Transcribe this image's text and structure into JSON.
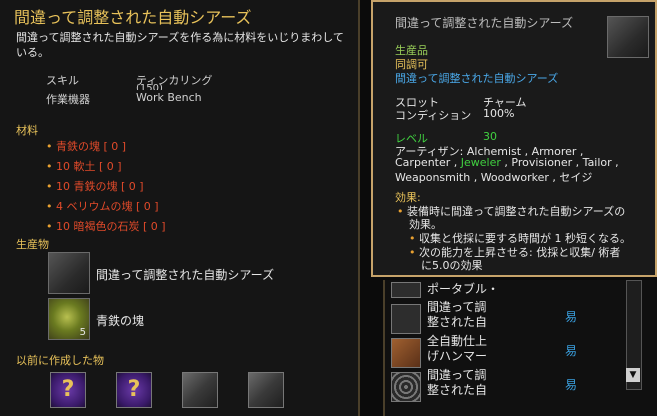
{
  "recipe": {
    "title": "間違って調整された自動シアーズ",
    "description": "間違って調整された自動シアーズを作る為に材料をいじりまわしている。",
    "skill_label": "スキル",
    "skill_value": "ティンカリング",
    "skill_sub": "(150)",
    "tool_label": "作業機器",
    "tool_value": "Work Bench",
    "materials_heading": "材料",
    "materials": [
      "青鉄の塊 [ 0 ]",
      "10 軟土 [ 0 ]",
      "10 青鉄の塊 [ 0 ]",
      "4 ベリウムの塊 [ 0 ]",
      "10 暗褐色の石炭 [ 0 ]"
    ],
    "products_heading": "生産物",
    "products": [
      {
        "name": "間違って調整された自動シアーズ",
        "icon": "scythe-icon",
        "count": ""
      },
      {
        "name": "青鉄の塊",
        "icon": "ore-icon",
        "count": "5"
      }
    ],
    "previous_heading": "以前に作成した物",
    "previous_items": [
      "question-icon",
      "question-icon",
      "scythe-icon",
      "scythe-icon"
    ]
  },
  "tooltip": {
    "title": "間違って調整された自動シアーズ",
    "line1": "生産品",
    "line2": "同調可",
    "line3": "間違って調整された自動シアーズ",
    "slot_label": "スロット",
    "slot_value": "チャーム",
    "condition_label": "コンディション",
    "condition_value": "100%",
    "level_label": "レベル",
    "level_value": "30",
    "artisans_label": "アーティザン:",
    "artisans_line1": "Alchemist , Armorer ,",
    "artisans_line2_a": "Carpenter ,",
    "artisans_line2_b": "Jeweler",
    "artisans_line2_c": ", Provisioner , Tailor ,",
    "artisans_line3": "Weaponsmith , Woodworker , セイジ",
    "effects_heading": "効果:",
    "effect1_a": "装備時に間違って調整された自動シアーズの",
    "effect1_b": "効果。",
    "effect2": "収集と伐採に要する時間が 1 秒短くなる。",
    "effect3_a": "次の能力を上昇させる: 伐採と収集/ 術者",
    "effect3_b": "に5.0の効果"
  },
  "list": {
    "rows": [
      {
        "name_a": "ポータブル・",
        "name_b": "",
        "difficulty": ""
      },
      {
        "name_a": "間違って調",
        "name_b": "整された自",
        "difficulty": "易"
      },
      {
        "name_a": "全自動仕上",
        "name_b": "げハンマー",
        "difficulty": "易"
      },
      {
        "name_a": "間違って調",
        "name_b": "整された自",
        "difficulty": "易"
      }
    ],
    "scroll_down": "▼"
  }
}
